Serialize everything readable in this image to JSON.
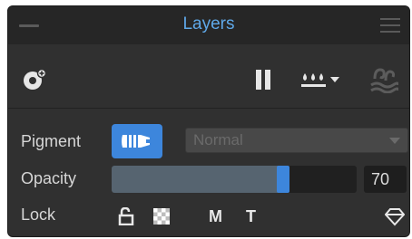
{
  "panel": {
    "title": "Layers",
    "accent_color": "#3d86dc",
    "title_color": "#5fa8e8"
  },
  "toolbar": {
    "icons": [
      "layer-add-icon",
      "pause-icon",
      "drops-dropdown-icon",
      "liquid-ink-icon"
    ]
  },
  "pigment": {
    "label": "Pigment",
    "button_icon": "pigment-icon",
    "blend_mode": "Normal"
  },
  "opacity": {
    "label": "Opacity",
    "value": "70",
    "fraction": 0.7
  },
  "lock": {
    "label": "Lock",
    "m_label": "M",
    "t_label": "T",
    "icons": [
      "unlock-icon",
      "checker-icon",
      "diamond-icon"
    ]
  }
}
